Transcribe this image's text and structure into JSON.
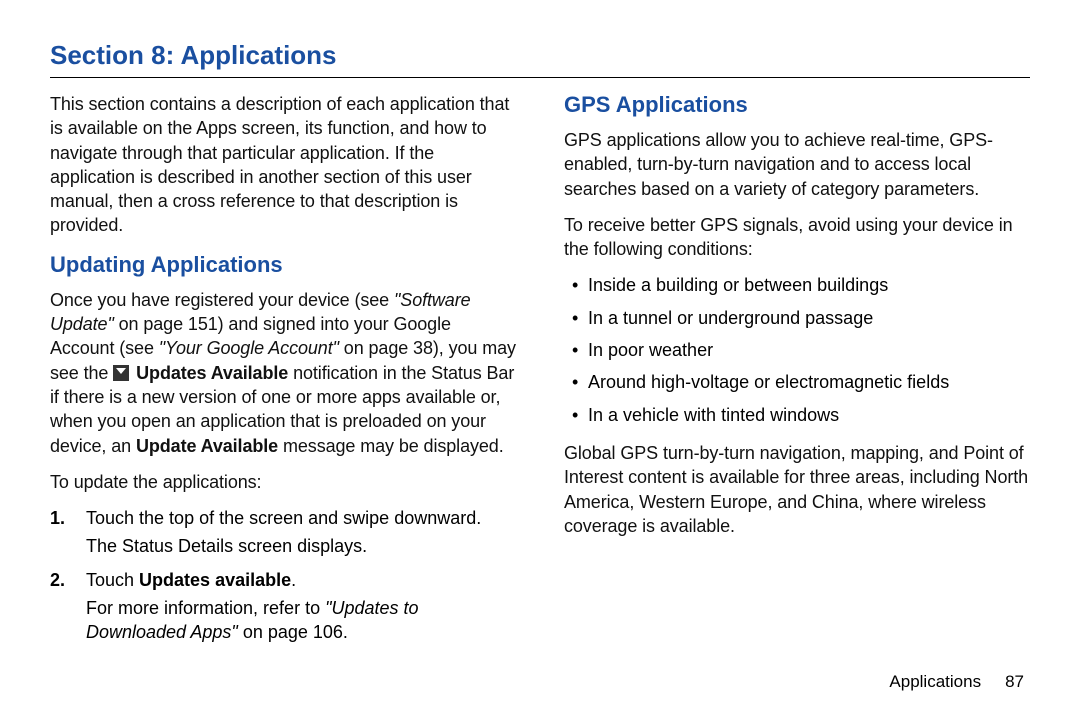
{
  "section_title": "Section 8: Applications",
  "left": {
    "intro": "This section contains a description of each application that is available on the Apps screen, its function, and how to navigate through that particular application. If the application is described in another section of this user manual, then a cross reference to that description is provided.",
    "heading": "Updating Applications",
    "para1_pre": "Once you have registered your device (see ",
    "para1_ref1": "\"Software Update\"",
    "para1_mid1": " on page 151) and signed into your Google Account (see ",
    "para1_ref2": "\"Your Google Account\"",
    "para1_mid2": " on page 38), you may see the ",
    "para1_bold1": "Updates Available",
    "para1_mid3": " notification in the Status Bar if there is a new version of one or more apps available or, when you open an application that is preloaded on your device, an ",
    "para1_bold2": "Update Available",
    "para1_post": " message may be displayed.",
    "to_update": "To update the applications:",
    "step1_num": "1.",
    "step1_text": "Touch the top of the screen and swipe downward.",
    "step1_sub": "The Status Details screen displays.",
    "step2_num": "2.",
    "step2_pre": "Touch ",
    "step2_bold": "Updates available",
    "step2_post": ".",
    "step2_sub_pre": "For more information, refer to ",
    "step2_sub_ref": "\"Updates to Downloaded Apps\"",
    "step2_sub_post": " on page 106."
  },
  "right": {
    "heading": "GPS Applications",
    "para1": "GPS applications allow you to achieve real-time, GPS-enabled, turn-by-turn navigation and to access local searches based on a variety of category parameters.",
    "para2": "To receive better GPS signals, avoid using your device in the following conditions:",
    "bullets": [
      "Inside a building or between buildings",
      "In a tunnel or underground passage",
      "In poor weather",
      "Around high-voltage or electromagnetic fields",
      "In a vehicle with tinted windows"
    ],
    "para3": "Global GPS turn-by-turn navigation, mapping, and Point of Interest content is available for three areas, including North America, Western Europe, and China, where wireless coverage is available."
  },
  "footer": {
    "label": "Applications",
    "page": "87"
  }
}
